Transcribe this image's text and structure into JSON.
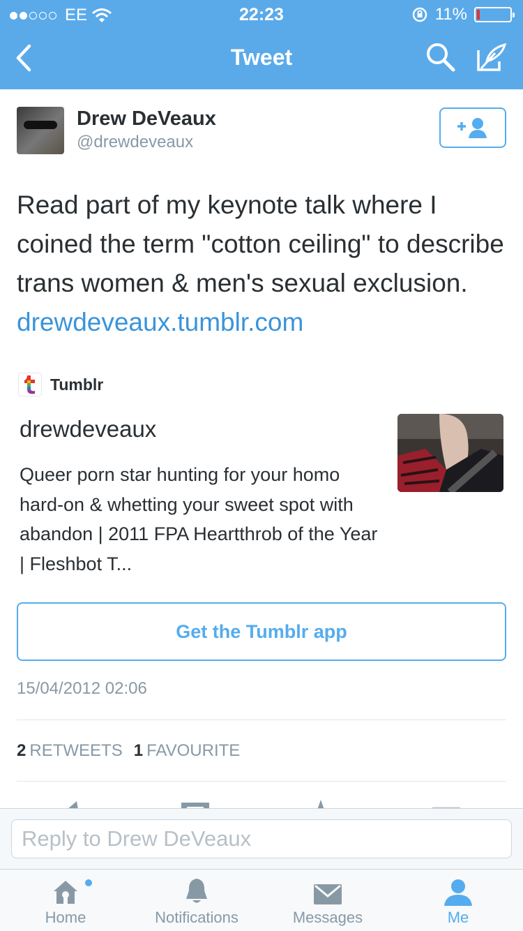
{
  "status_bar": {
    "carrier": "EE",
    "time": "22:23",
    "battery": "11%"
  },
  "nav": {
    "title": "Tweet"
  },
  "tweet": {
    "author_name": "Drew DeVeaux",
    "author_handle": "@drewdeveaux",
    "text": "Read part of my keynote talk where I coined the term \"cotton ceiling\" to describe trans women & men's sexual exclusion. ",
    "link": "drewdeveaux.tumblr.com",
    "timestamp": "15/04/2012 02:06",
    "retweets_count": "2",
    "retweets_label": "RETWEETS",
    "favourites_count": "1",
    "favourites_label": "FAVOURITE"
  },
  "card": {
    "source": "Tumblr",
    "title": "drewdeveaux",
    "description": "Queer porn star hunting for your homo hard-on & whetting your sweet spot with abandon | 2011 FPA Heartthrob of the Year | Fleshbot T...",
    "cta": "Get the Tumblr app"
  },
  "reply": {
    "placeholder": "Reply to Drew DeVeaux"
  },
  "tabs": [
    {
      "label": "Home",
      "icon": "home-icon"
    },
    {
      "label": "Notifications",
      "icon": "bell-icon"
    },
    {
      "label": "Messages",
      "icon": "envelope-icon"
    },
    {
      "label": "Me",
      "icon": "person-icon"
    }
  ],
  "colors": {
    "brand": "#5aaaea",
    "link": "#3b94d9",
    "muted": "#8899a6",
    "battery_low": "#e8312f"
  }
}
